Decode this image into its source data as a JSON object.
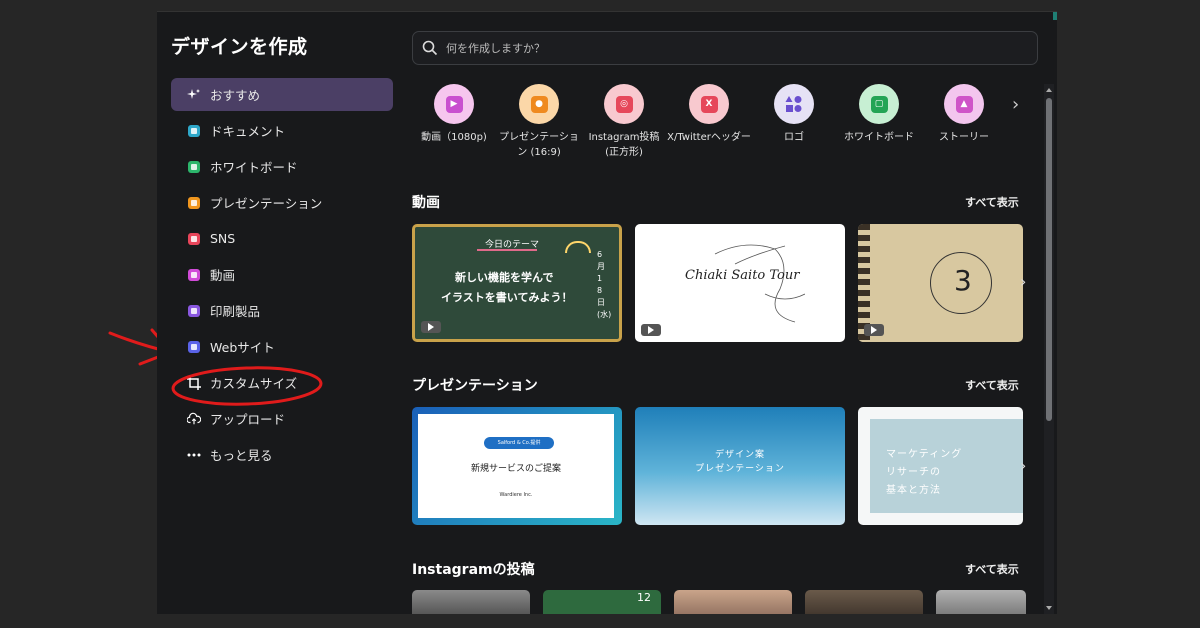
{
  "sidebar": {
    "title": "デザインを作成",
    "items": [
      {
        "label": "おすすめ",
        "icon": "sparkle-icon",
        "color": "#ffffff"
      },
      {
        "label": "ドキュメント",
        "icon": "document-icon",
        "color": "#2ea7c9"
      },
      {
        "label": "ホワイトボード",
        "icon": "whiteboard-icon",
        "color": "#2cb56b"
      },
      {
        "label": "プレゼンテーション",
        "icon": "presentation-icon",
        "color": "#f0961e"
      },
      {
        "label": "SNS",
        "icon": "heart-icon",
        "color": "#e8455a"
      },
      {
        "label": "動画",
        "icon": "video-icon",
        "color": "#d14bd8"
      },
      {
        "label": "印刷製品",
        "icon": "printer-icon",
        "color": "#8a58e0"
      },
      {
        "label": "Webサイト",
        "icon": "website-icon",
        "color": "#5a63e8"
      },
      {
        "label": "カスタムサイズ",
        "icon": "custom-size-icon",
        "color": "#ffffff"
      },
      {
        "label": "アップロード",
        "icon": "cloud-upload-icon",
        "color": "#ffffff"
      },
      {
        "label": "もっと見る",
        "icon": "more-icon",
        "color": "#ffffff"
      }
    ]
  },
  "search": {
    "placeholder": "何を作成しますか？"
  },
  "categories": [
    {
      "label": "動画（1080p)",
      "icon": "video-icon",
      "bg": "#f6c6ee",
      "badge": "#c94fcf"
    },
    {
      "label": "プレゼンテーション (16:9)",
      "icon": "presentation-icon",
      "bg": "#fbd7a8",
      "badge": "#ef8a1f"
    },
    {
      "label": "Instagram投稿 (正方形)",
      "icon": "instagram-icon",
      "bg": "#f8c9cf",
      "badge": "#e6475a"
    },
    {
      "label": "X/Twitterヘッダー",
      "icon": "x-icon",
      "bg": "#f8c9cf",
      "badge": "#e6475a"
    },
    {
      "label": "ロゴ",
      "icon": "logo-shapes-icon",
      "bg": "#e6e2f5",
      "badge": "#6a4fcf"
    },
    {
      "label": "ホワイトボード",
      "icon": "whiteboard-icon",
      "bg": "#c7efd3",
      "badge": "#23a455"
    },
    {
      "label": "ストーリー",
      "icon": "story-icon",
      "bg": "#f3c6ee",
      "badge": "#cf55c8"
    }
  ],
  "sections": {
    "video": {
      "title": "動画",
      "see_all": "すべて表示",
      "card1": {
        "line1": "今日のテーマ",
        "line2": "新しい機能を学んで",
        "line3": "イラストを書いてみよう！",
        "date": "6月18日(水)"
      },
      "card2": {
        "text": "Chiaki Saito Tour"
      },
      "card3": {
        "text": "3"
      }
    },
    "presentation": {
      "title": "プレゼンテーション",
      "see_all": "すべて表示",
      "card1": {
        "badge": "Salford & Co.提供",
        "title": "新規サービスのご提案",
        "company": "Wardiere Inc."
      },
      "card2": {
        "line1": "デザイン案",
        "line2": "プレゼンテーション"
      },
      "card3": {
        "line1": "マーケティング",
        "line2": "リサーチの",
        "line3": "基本と方法"
      }
    },
    "instagram": {
      "title": "Instagramの投稿",
      "see_all": "すべて表示",
      "card2": {
        "text": "12"
      }
    }
  },
  "colors": {
    "accent": "#4b3f65",
    "annotation": "#e01b1b"
  }
}
